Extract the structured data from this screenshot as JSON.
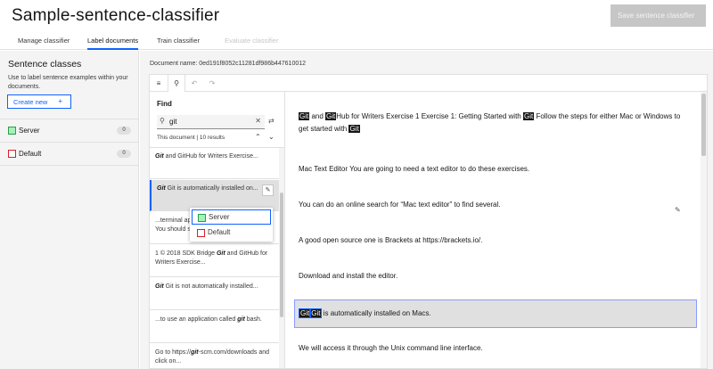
{
  "app": {
    "title": "Sample-sentence-classifier",
    "save_label": "Save sentence classifier"
  },
  "tabs": [
    {
      "label": "Manage classifier",
      "state": "normal"
    },
    {
      "label": "Label documents",
      "state": "active"
    },
    {
      "label": "Train classifier",
      "state": "normal"
    },
    {
      "label": "Evaluate classifier",
      "state": "disabled"
    }
  ],
  "sidebar": {
    "title": "Sentence classes",
    "description": "Use to label sentence examples within your documents.",
    "create_label": "Create new",
    "classes": [
      {
        "label": "Server",
        "count": "0",
        "color": "#24a148"
      },
      {
        "label": "Default",
        "count": "0",
        "color": "#da1e28"
      }
    ]
  },
  "document": {
    "name_label": "Document name: 0ed191f8052c11281df986b447610012"
  },
  "toolbar": {
    "icons": [
      "list-icon",
      "search-icon",
      "undo-icon",
      "redo-icon"
    ]
  },
  "find": {
    "title": "Find",
    "query": "git",
    "scope_text": "This document | 10 results",
    "results": [
      {
        "pre": "",
        "match": "Git",
        "post": " and GitHub for Writers Exercise..."
      },
      {
        "pre": "",
        "match": "Git",
        "post": " Git is automatically installed on..."
      },
      {
        "pre": "...terminal ap",
        "match": "",
        "post": "You should s..."
      },
      {
        "pre": "1 © 2018 SDK Bridge ",
        "match": "Git",
        "post": " and GitHub for Writers Exercise..."
      },
      {
        "pre": "",
        "match": "Git",
        "post": " Git is not automatically installed..."
      },
      {
        "pre": "...to use an application called ",
        "match": "git",
        "post": " bash."
      },
      {
        "pre": "Go to https://",
        "match": "git",
        "post": "-scm.com/downloads and click on..."
      }
    ]
  },
  "popup": {
    "items": [
      {
        "label": "Server",
        "color": "#24a148"
      },
      {
        "label": "Default",
        "color": "#da1e28"
      }
    ]
  },
  "sentences": {
    "s1": {
      "a": "Git",
      "b": " and ",
      "c": "Git",
      "d": "Hub for Writers Exercise 1 Exercise 1: Getting Started with ",
      "e": "Git",
      "f": " Follow the steps for either Mac or Windows to get started with ",
      "g": "Git"
    },
    "s2": "Mac Text Editor You are going to need a text editor to do these exercises.",
    "s3": "You can do an online search for “Mac text editor” to find several.",
    "s4": "A good open source one is Brackets at https://brackets.io/.",
    "s5": "Download and install the editor.",
    "s6": {
      "a": "Git",
      "b": "Git",
      "c": " is automatically installed on Macs."
    },
    "s7": "We will access it through the Unix command line interface."
  }
}
